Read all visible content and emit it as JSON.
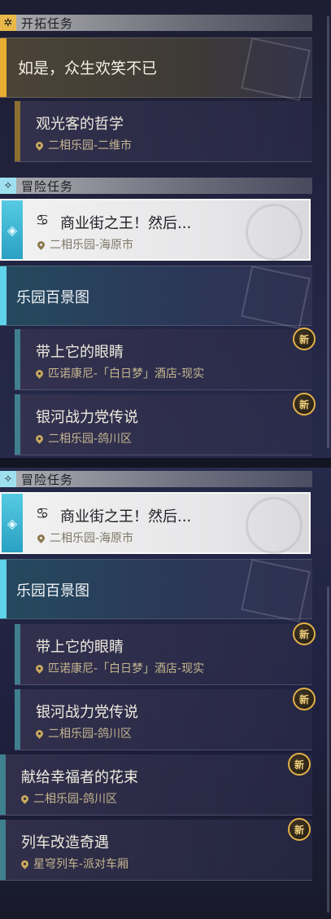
{
  "sections": {
    "trailblaze": "开拓任务",
    "adventure": "冒险任务",
    "adventure2": "冒险任务"
  },
  "trailblaze_main": {
    "title": "如是，众生欢笑不已"
  },
  "trailblaze_sub": {
    "title": "观光客的哲学",
    "location": "二相乐园-二维市"
  },
  "adventure_selected": {
    "icon": "mission-icon",
    "title": "商业街之王！然后...",
    "location": "二相乐园-海原市"
  },
  "adventure_selected2": {
    "icon": "mission-icon",
    "title": "商业街之王！然后...",
    "location": "二相乐园-海原市"
  },
  "group": {
    "title": "乐园百景图"
  },
  "group2": {
    "title": "乐园百景图"
  },
  "quests_a": [
    {
      "title": "带上它的眼睛",
      "location": "匹诺康尼-「白日梦」酒店-现实",
      "badge": "新"
    },
    {
      "title": "银河战力党传说",
      "location": "二相乐园-鸽川区",
      "badge": "新"
    }
  ],
  "quests_b": [
    {
      "title": "带上它的眼睛",
      "location": "匹诺康尼-「白日梦」酒店-现实",
      "badge": "新"
    },
    {
      "title": "银河战力党传说",
      "location": "二相乐园-鸽川区",
      "badge": "新"
    }
  ],
  "quests_c": [
    {
      "title": "献给幸福者的花束",
      "location": "二相乐园-鸽川区",
      "badge": "新"
    },
    {
      "title": "列车改造奇遇",
      "location": "星穹列车-派对车厢",
      "badge": "新"
    }
  ],
  "colors": {
    "gold_accent": "#e7ad32",
    "teal_accent": "#5fd3ea",
    "badge_border": "#e2b048"
  }
}
